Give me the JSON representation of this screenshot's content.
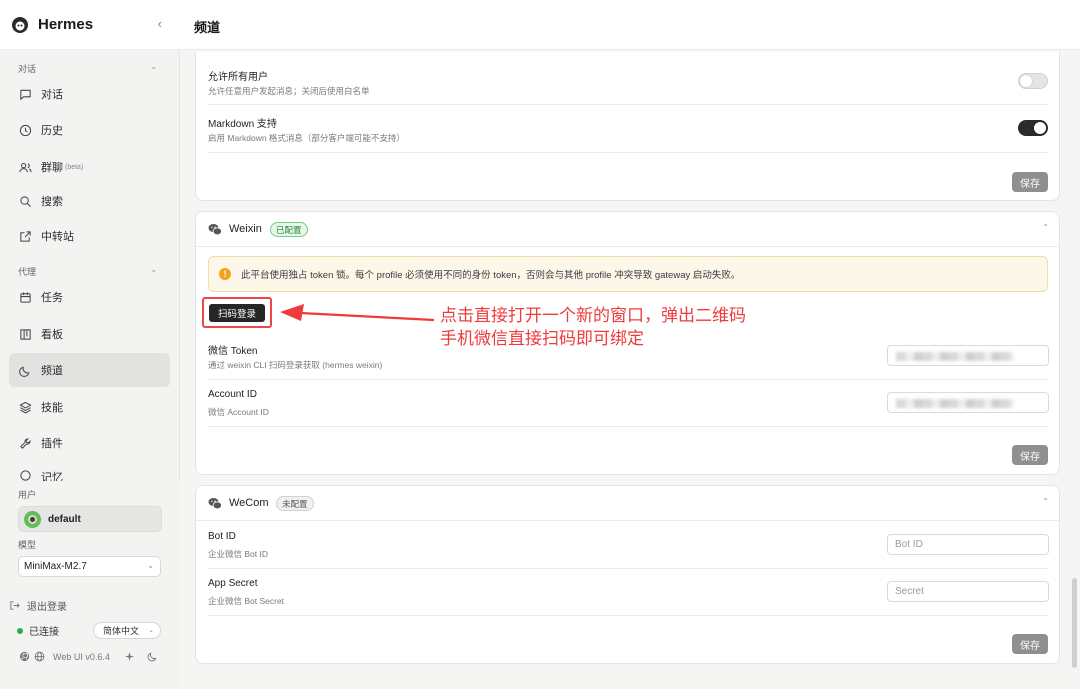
{
  "sidebar": {
    "brand": "Hermes",
    "sections": {
      "chat": "对话",
      "agent": "代理"
    },
    "items": {
      "chat": "对话",
      "history": "历史",
      "group": "群聊",
      "group_beta": "(beta)",
      "search": "搜索",
      "relay": "中转站",
      "tasks": "任务",
      "board": "看板",
      "channels": "频道",
      "skills": "技能",
      "plugins": "插件",
      "memory": "记忆"
    },
    "user_label": "用户",
    "user_name": "default",
    "model_label": "模型",
    "model_value": "MiniMax-M2.7",
    "logout": "退出登录",
    "status": "已连接",
    "language": "简体中文",
    "version": "Web UI v0.6.4"
  },
  "header": {
    "title": "频道"
  },
  "general_card": {
    "allow_all": {
      "title": "允许所有用户",
      "desc": "允许任意用户发起消息；关闭后使用白名单",
      "enabled": false
    },
    "markdown": {
      "title": "Markdown 支持",
      "desc": "启用 Markdown 格式消息（部分客户端可能不支持）",
      "enabled": true
    },
    "save": "保存"
  },
  "weixin_card": {
    "title": "Weixin",
    "badge": "已配置",
    "warning": "此平台使用独占 token 锁。每个 profile 必须使用不同的身份 token，否则会与其他 profile 冲突导致 gateway 启动失败。",
    "scan_button": "扫码登录",
    "token": {
      "title": "微信 Token",
      "desc": "通过 weixin CLI 扫码登录获取 (hermes weixin)"
    },
    "account": {
      "title": "Account ID",
      "desc": "微信 Account ID"
    },
    "save": "保存"
  },
  "wecom_card": {
    "title": "WeCom",
    "badge": "未配置",
    "bot_id": {
      "title": "Bot ID",
      "desc": "企业微信 Bot ID",
      "placeholder": "Bot ID"
    },
    "app_secret": {
      "title": "App Secret",
      "desc": "企业微信 Bot Secret",
      "placeholder": "Secret"
    },
    "save": "保存"
  },
  "annotation": {
    "line1": "点击直接打开一个新的窗口，弹出二维码",
    "line2": "手机微信直接扫码即可绑定"
  },
  "colors": {
    "annotation": "#ee3b3b",
    "configured": "#22893a",
    "warning": "#f3a21c"
  }
}
